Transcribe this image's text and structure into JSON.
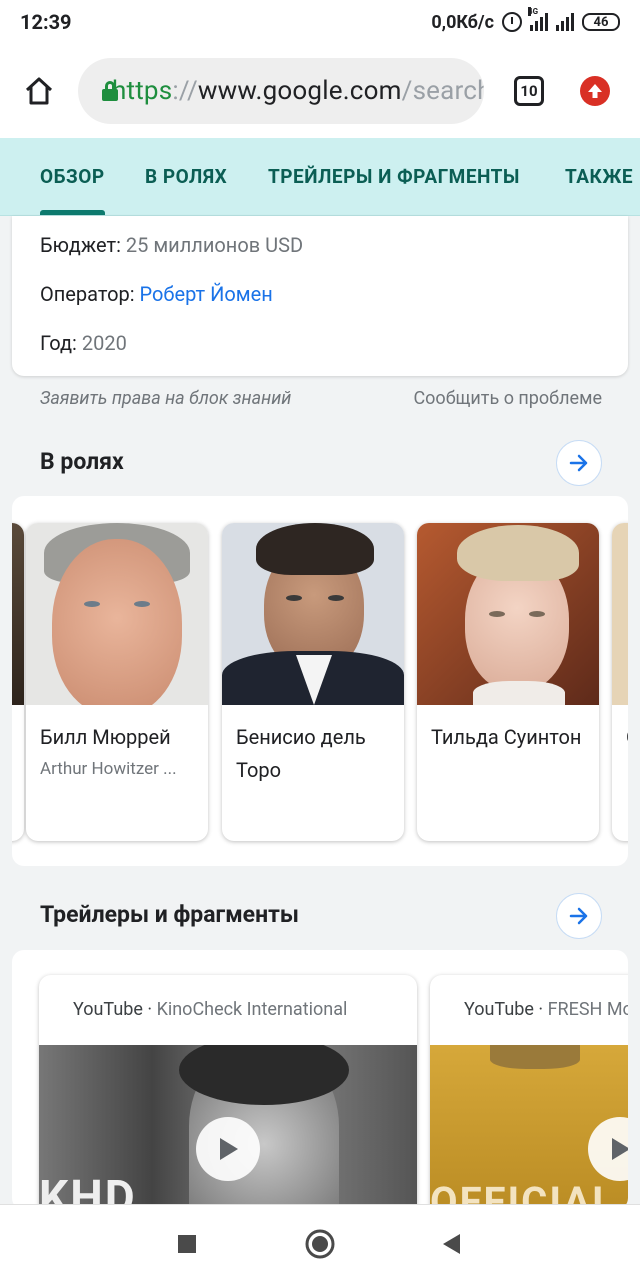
{
  "status_bar": {
    "time": "12:39",
    "speed": "0,0Кб/с",
    "network": "4G",
    "battery": "46"
  },
  "browser": {
    "url_scheme": "https",
    "url_sep": "://",
    "url_host": "www.google.com",
    "url_tail": "/search",
    "tab_count": "10"
  },
  "tabs": [
    {
      "label": "ОБЗОР",
      "active": true
    },
    {
      "label": "В РОЛЯХ",
      "active": false
    },
    {
      "label": "ТРЕЙЛЕРЫ И ФРАГМЕНТЫ",
      "active": false
    },
    {
      "label": "ТАКЖЕ",
      "active": false
    }
  ],
  "info": {
    "budget_label": "Бюджет:",
    "budget_value": "25 миллионов USD",
    "operator_label": "Оператор:",
    "operator_value": "Роберт Йомен",
    "year_label": "Год:",
    "year_value": "2020"
  },
  "feedback": {
    "claim": "Заявить права на блок знаний",
    "report": "Сообщить о проблеме"
  },
  "cast": {
    "title": "В ролях",
    "items": [
      {
        "name": "Билл Мюррей",
        "role": "Arthur Howitzer ..."
      },
      {
        "name": "Бенисио дель Торо",
        "role": ""
      },
      {
        "name": "Тильда Суинтон",
        "role": ""
      },
      {
        "name": "О",
        "role": ""
      }
    ]
  },
  "trailers": {
    "title": "Трейлеры и фрагменты",
    "items": [
      {
        "source": "YouTube",
        "channel": "KinoCheck International",
        "overlay": "KHD"
      },
      {
        "source": "YouTube",
        "channel": "FRESH Mo",
        "overlay": "OFFICIAL"
      }
    ]
  },
  "colors": {
    "tabs_bg": "#cdf0f0",
    "tab_text": "#0b5e54",
    "link": "#1a73e8",
    "secure": "#1e8e3e",
    "update": "#d93025"
  }
}
